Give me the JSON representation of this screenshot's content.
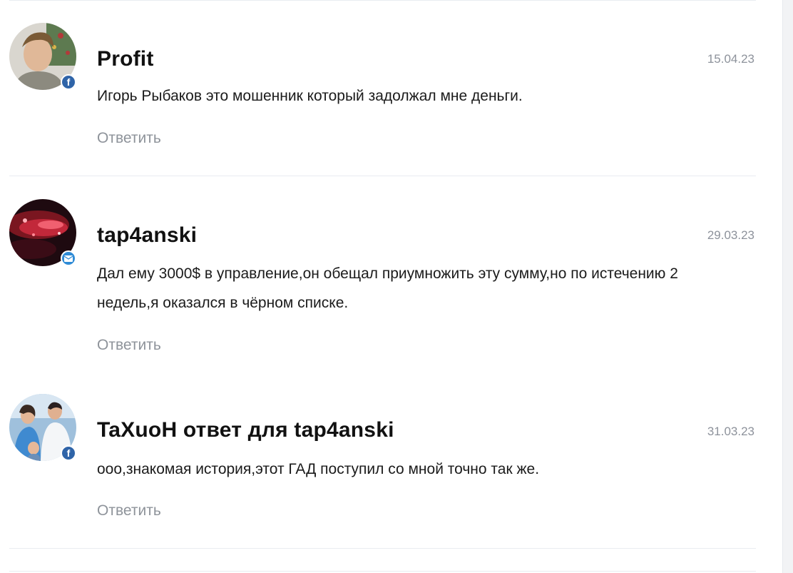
{
  "comments": [
    {
      "author": "Profit",
      "date": "15.04.23",
      "text": "Игорь Рыбаков это мошенник который задолжал мне деньги.",
      "reply_label": "Ответить",
      "avatar": "user-photo",
      "badge_icon": "facebook-icon",
      "badge_glyph": "f"
    },
    {
      "author": "tap4anski",
      "date": "29.03.23",
      "text": "Дал ему 3000$ в управление,он обещал приумножить эту сумму,но по истечению 2 недель,я оказался в чёрном списке.",
      "reply_label": "Ответить",
      "avatar": "red-abstract-image",
      "badge_icon": "mail-icon",
      "badge_glyph": ""
    },
    {
      "author": "TaXuoH ответ для tap4anski",
      "date": "31.03.23",
      "text": "ооо,знакомая история,этот ГАД поступил со мной точно так же.",
      "reply_label": "Ответить",
      "avatar": "family-photo",
      "badge_icon": "facebook-icon",
      "badge_glyph": "f"
    }
  ]
}
